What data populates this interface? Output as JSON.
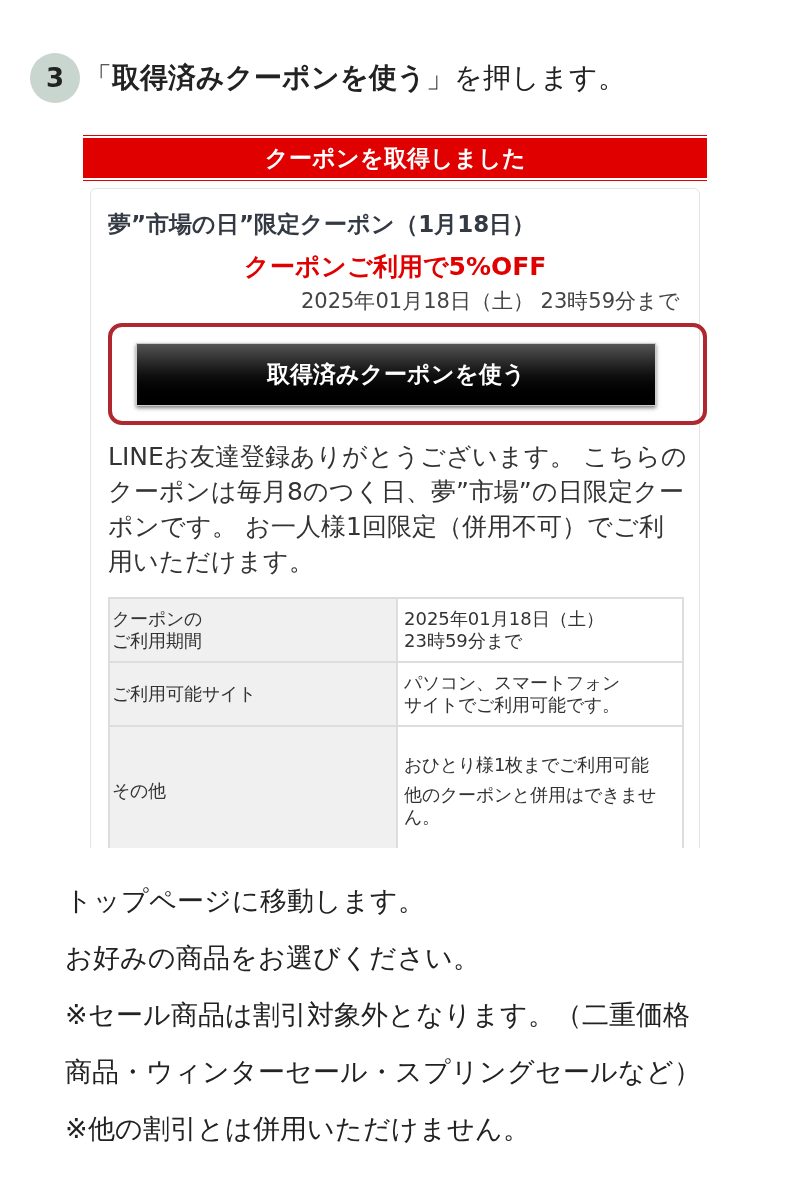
{
  "step": {
    "number": "3",
    "instruction": "「**取得済みクーポンを使う**」を押します。"
  },
  "screenshot": {
    "banner": "クーポンを取得しました",
    "coupon_title": "夢”市場の日”限定クーポン（1月18日）",
    "discount": "クーポンご利用で5%OFF",
    "deadline": "2025年01月18日（土） 23時59分まで",
    "use_button": "取得済みクーポンを使う",
    "description": "LINEお友達登録ありがとうございます。 こちらのクーポンは毎月8のつく日、夢”市場”の日限定クーポンです。 お一人様1回限定（併用不可）でご利用いただけます。",
    "table": {
      "rows": [
        {
          "label": [
            "クーポンの",
            "ご利用期間"
          ],
          "value": [
            "2025年01月18日（土）",
            "23時59分まで"
          ],
          "kind": "lines"
        },
        {
          "label": [
            "ご利用可能サイト"
          ],
          "value": [
            "パソコン、スマートフォン",
            "サイトでご利用可能です。"
          ],
          "kind": "lines"
        },
        {
          "label": [
            "その他"
          ],
          "value": [
            "おひとり様1枚までご利用可能",
            "他のクーポンと併用はできません。"
          ],
          "kind": "paragraphs"
        }
      ]
    }
  },
  "notes": [
    "トップページに移動します。",
    "お好みの商品をお選びください。",
    "※セール商品は割引対象外となります。（二重価格",
    "商品・ウィンターセール・スプリングセールなど）",
    "※他の割引とは併用いただけません。"
  ]
}
